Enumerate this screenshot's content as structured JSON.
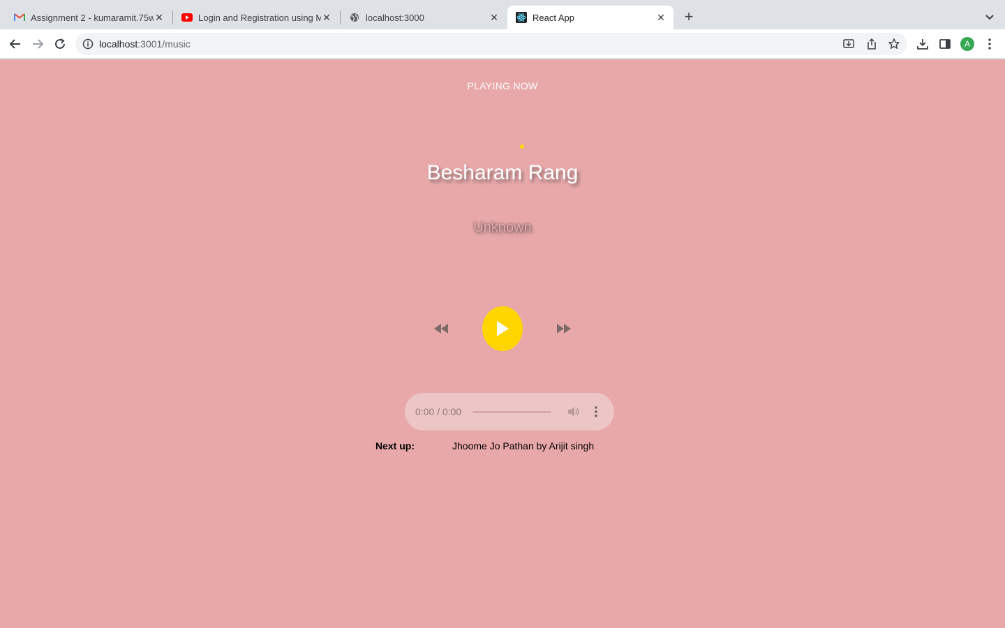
{
  "browser": {
    "tabs": [
      {
        "title": "Assignment 2 - kumaramit.75w",
        "favicon": "gmail-icon",
        "active": false
      },
      {
        "title": "Login and Registration using M",
        "favicon": "youtube-icon",
        "active": false
      },
      {
        "title": "localhost:3000",
        "favicon": "globe-icon",
        "active": false
      },
      {
        "title": "React App",
        "favicon": "react-icon",
        "active": true
      }
    ],
    "url_host": "localhost",
    "url_path": ":3001/music",
    "profile_initial": "A"
  },
  "player": {
    "status": "PLAYING NOW",
    "song_title": "Besharam Rang",
    "artist": "Unknown",
    "audio_time": "0:00 / 0:00",
    "next_up_label": "Next up:",
    "next_up_value": "Jhoome Jo Pathan by Arijit singh"
  },
  "colors": {
    "page_background": "#e8a8a9",
    "accent": "#ffd500"
  }
}
